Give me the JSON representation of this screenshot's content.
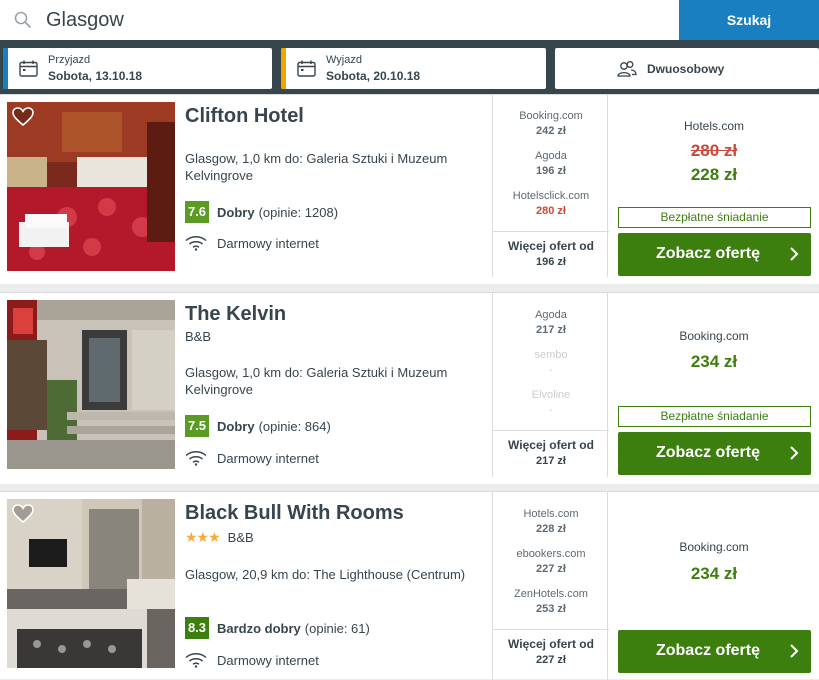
{
  "search": {
    "value": "Glasgow",
    "button_label": "Szukaj"
  },
  "filters": {
    "checkin": {
      "label": "Przyjazd",
      "value": "Sobota, 13.10.18"
    },
    "checkout": {
      "label": "Wyjazd",
      "value": "Sobota, 20.10.18"
    },
    "room": {
      "label": "Dwuosobowy"
    }
  },
  "colors": {
    "accent_blue": "#1a7fc1",
    "accent_orange": "#f0a500",
    "green": "#3d7f0e",
    "red": "#c94a3a",
    "dark": "#37454d"
  },
  "hotels": [
    {
      "name": "Clifton Hotel",
      "subtitle": "",
      "location": "Glasgow, 1,0 km do: Galeria Sztuki i Muzeum Kelvingrove",
      "rating": {
        "score": "7.6",
        "label": "Dobry",
        "count": "(opinie: 1208)"
      },
      "amenity": "Darmowy internet",
      "deals": [
        {
          "site": "Booking.com",
          "price": "242 zł"
        },
        {
          "site": "Agoda",
          "price": "196 zł"
        },
        {
          "site": "Hotelsclick.com",
          "price": "280 zł"
        }
      ],
      "more": {
        "label": "Więcej ofert od",
        "price": "196 zł"
      },
      "best": {
        "site": "Hotels.com",
        "old_price": "280 zł",
        "price": "228 zł"
      },
      "badge": "Bezpłatne śniadanie",
      "cta": "Zobacz ofertę"
    },
    {
      "name": "The Kelvin",
      "subtitle": "B&B",
      "location": "Glasgow, 1,0 km do: Galeria Sztuki i Muzeum Kelvingrove",
      "rating": {
        "score": "7.5",
        "label": "Dobry",
        "count": "(opinie: 864)"
      },
      "amenity": "Darmowy internet",
      "deals": [
        {
          "site": "Agoda",
          "price": "217 zł"
        },
        {
          "site": "sembo",
          "price": "-"
        },
        {
          "site": "Elvoline",
          "price": "-"
        }
      ],
      "more": {
        "label": "Więcej ofert od",
        "price": "217 zł"
      },
      "best": {
        "site": "Booking.com",
        "price": "234 zł"
      },
      "badge": "Bezpłatne śniadanie",
      "cta": "Zobacz ofertę"
    },
    {
      "name": "Black Bull With Rooms",
      "stars": "★★★",
      "subtitle": "B&B",
      "location": "Glasgow, 20,9 km do: The Lighthouse (Centrum)",
      "rating": {
        "score": "8.3",
        "label": "Bardzo dobry",
        "count": "(opinie: 61)"
      },
      "amenity": "Darmowy internet",
      "deals": [
        {
          "site": "Hotels.com",
          "price": "228 zł"
        },
        {
          "site": "ebookers.com",
          "price": "227 zł"
        },
        {
          "site": "ZenHotels.com",
          "price": "253 zł"
        }
      ],
      "more": {
        "label": "Więcej ofert od",
        "price": "227 zł"
      },
      "best": {
        "site": "Booking.com",
        "price": "234 zł"
      },
      "cta": "Zobacz ofertę"
    }
  ]
}
